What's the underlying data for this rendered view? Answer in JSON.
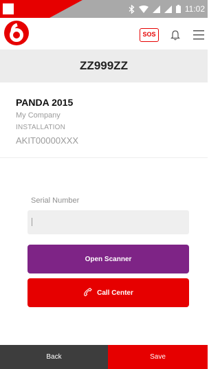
{
  "status_bar": {
    "time": "11:02",
    "icons": [
      "bluetooth-icon",
      "wifi-icon",
      "signal-icon",
      "signal-icon",
      "battery-icon"
    ]
  },
  "header": {
    "logo": "vodafone-logo",
    "sos_label": "SOS",
    "icons": [
      "bell-icon",
      "menu-icon"
    ]
  },
  "title": "ZZ999ZZ",
  "info": {
    "name": "PANDA 2015",
    "company": "My Company",
    "role": "INSTALLATION",
    "code": "AKIT00000XXX"
  },
  "form": {
    "serial_label": "Serial Number",
    "serial_value": ""
  },
  "buttons": {
    "scanner": "Open Scanner",
    "call_center": "Call Center"
  },
  "footer": {
    "back": "Back",
    "save": "Save"
  },
  "colors": {
    "brand_red": "#e60000",
    "purple": "#7e2486",
    "footer_dark": "#3d3d3d",
    "title_band": "#ececec"
  }
}
